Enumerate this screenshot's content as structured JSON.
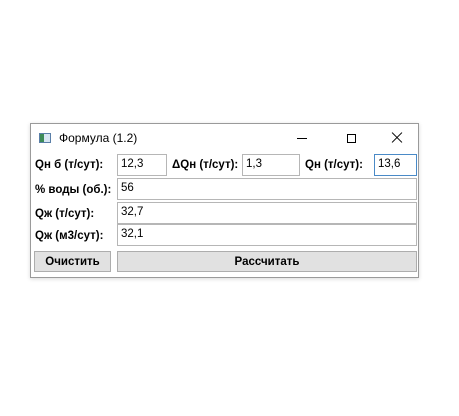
{
  "window": {
    "title": "Формула (1.2)"
  },
  "fields": {
    "qn_b_label": "Qн б (т/сут):",
    "qn_b_value": "12,3",
    "dqn_label": "ΔQн (т/сут):",
    "dqn_value": "1,3",
    "qn_label": "Qн (т/сут):",
    "qn_value": "13,6",
    "water_label": "% воды (об.):",
    "water_value": "56",
    "qzh_t_label": "Qж (т/сут):",
    "qzh_t_value": "32,7",
    "qzh_m3_label": "Qж (м3/сут):",
    "qzh_m3_value": "32,1"
  },
  "buttons": {
    "clear_label": "Очистить",
    "calculate_label": "Рассчитать"
  }
}
